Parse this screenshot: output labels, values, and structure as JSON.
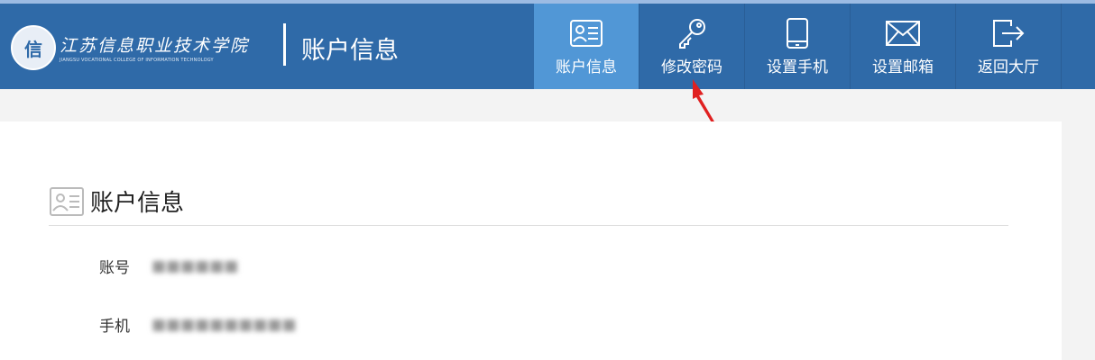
{
  "header": {
    "logo": {
      "seal_text": "信",
      "name_cn": "江苏信息职业技术学院",
      "name_en": "JIANGSU VOCATIONAL COLLEGE OF INFORMATION TECHNOLOGY"
    },
    "page_title": "账户信息",
    "nav": [
      {
        "label": "账户信息",
        "icon": "id-card-icon",
        "active": true
      },
      {
        "label": "修改密码",
        "icon": "key-icon",
        "active": false
      },
      {
        "label": "设置手机",
        "icon": "phone-icon",
        "active": false
      },
      {
        "label": "设置邮箱",
        "icon": "envelope-icon",
        "active": false
      },
      {
        "label": "返回大厅",
        "icon": "exit-icon",
        "active": false
      }
    ]
  },
  "colors": {
    "header_bg": "#2f6aa8",
    "nav_active_bg": "#5197d6",
    "annotation_arrow": "#e02020"
  },
  "content": {
    "section_title": "账户信息",
    "fields": [
      {
        "label": "账号",
        "value": "■■■■■■"
      },
      {
        "label": "手机",
        "value": "■■■■■■■■■■"
      }
    ]
  }
}
